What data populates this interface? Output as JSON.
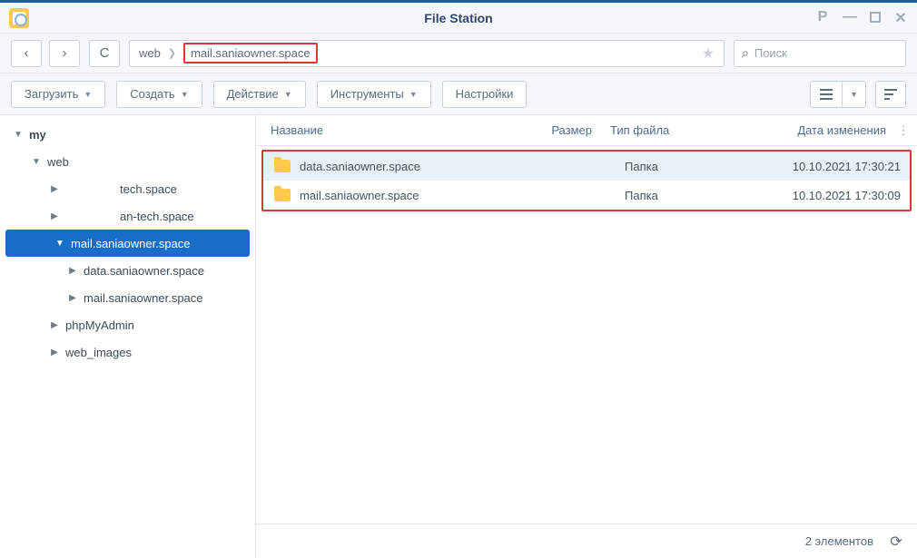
{
  "window": {
    "title": "File Station",
    "controls": {
      "help": "?",
      "min": "—",
      "max": "max",
      "close": "✕"
    }
  },
  "nav": {
    "back": "‹",
    "forward": "›",
    "reload": "↻"
  },
  "path": {
    "segments": [
      "web",
      "mail.saniaowner.space"
    ],
    "star": "★"
  },
  "search": {
    "placeholder": "Поиск"
  },
  "toolbar": {
    "upload": "Загрузить",
    "create": "Создать",
    "action": "Действие",
    "tools": "Инструменты",
    "settings": "Настройки"
  },
  "tree": {
    "root": "my",
    "web": "web",
    "items_level2": [
      "tech.space",
      "an-tech.space"
    ],
    "selected": "mail.saniaowner.space",
    "selected_children": [
      "data.saniaowner.space",
      "mail.saniaowner.space"
    ],
    "siblings_after": [
      "phpMyAdmin",
      "web_images"
    ]
  },
  "columns": {
    "name": "Название",
    "size": "Размер",
    "type": "Тип файла",
    "date": "Дата изменения"
  },
  "rows": [
    {
      "name": "data.saniaowner.space",
      "size": "",
      "type": "Папка",
      "date": "10.10.2021 17:30:21",
      "selected": true
    },
    {
      "name": "mail.saniaowner.space",
      "size": "",
      "type": "Папка",
      "date": "10.10.2021 17:30:09",
      "selected": false
    }
  ],
  "status": {
    "count": "2 элементов"
  }
}
